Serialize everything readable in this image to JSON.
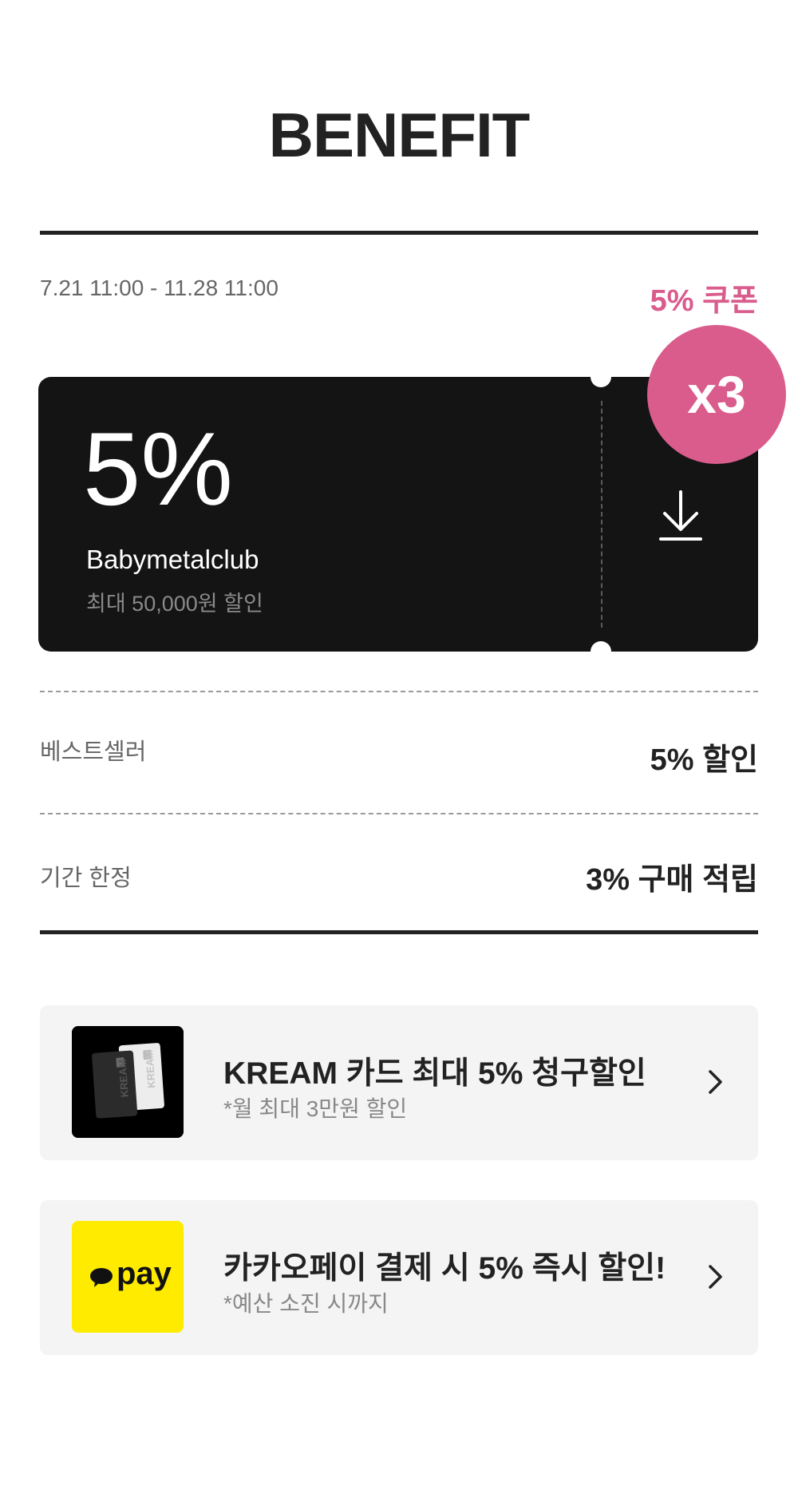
{
  "page": {
    "title": "BENEFIT"
  },
  "coupon": {
    "period": "7.21 11:00 - 11.28 11:00",
    "tag": "5% 쿠폰",
    "percent": "5%",
    "brand": "Babymetalclub",
    "limit": "최대 50,000원 할인",
    "count_badge": "x3",
    "download_icon": "download-icon"
  },
  "benefits": [
    {
      "label": "베스트셀러",
      "value": "5% 할인"
    },
    {
      "label": "기간 한정",
      "value": "3% 구매 적립"
    }
  ],
  "promos": [
    {
      "title": "KREAM 카드 최대 5% 청구할인",
      "subtitle": "*월 최대 3만원 할인",
      "thumb_text": "KREAM",
      "thumb_icon": "kream-card-image"
    },
    {
      "title": "카카오페이 결제 시 5% 즉시 할인!",
      "subtitle": "*예산 소진 시까지",
      "thumb_text": "pay",
      "thumb_icon": "kakaopay-logo"
    }
  ],
  "colors": {
    "accent_pink": "#d95c8c",
    "ticket_black": "#141414",
    "kakao_yellow": "#ffeb00"
  }
}
